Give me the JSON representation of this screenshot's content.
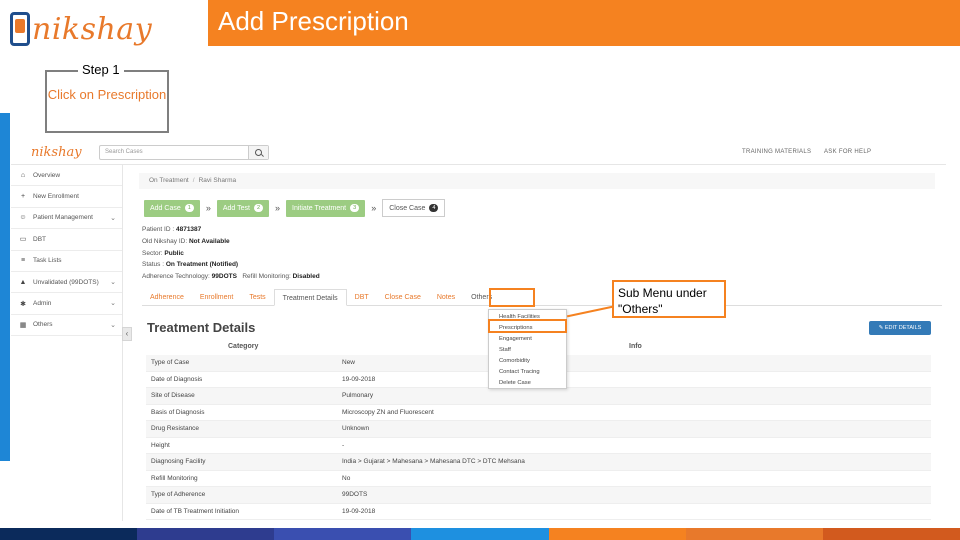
{
  "slide": {
    "logo_text": "nikshay",
    "title": "Add Prescription",
    "step_label": "Step 1",
    "step_text": "Click on Prescription",
    "callout_text": "Sub Menu under \"Others\"",
    "bottom_colors": [
      "#0b2a5b",
      "#2e3c8f",
      "#3a4fb0",
      "#1e90e0",
      "#f58220",
      "#e8792b",
      "#d25a1e"
    ]
  },
  "app": {
    "logo_text": "nikshay",
    "search_placeholder": "Search Cases",
    "top_links": [
      "TRAINING MATERIALS",
      "ASK FOR HELP"
    ],
    "sidebar": [
      {
        "icon": "home-icon",
        "glyph": "⌂",
        "label": "Overview",
        "chevron": false
      },
      {
        "icon": "plus-icon",
        "glyph": "+",
        "label": "New Enrollment",
        "chevron": false
      },
      {
        "icon": "user-icon",
        "glyph": "☺",
        "label": "Patient Management",
        "chevron": true
      },
      {
        "icon": "card-icon",
        "glyph": "▭",
        "label": "DBT",
        "chevron": false
      },
      {
        "icon": "list-icon",
        "glyph": "≡",
        "label": "Task Lists",
        "chevron": false
      },
      {
        "icon": "alert-icon",
        "glyph": "▲",
        "label": "Unvalidated (99DOTS)",
        "chevron": true
      },
      {
        "icon": "gear-icon",
        "glyph": "✱",
        "label": "Admin",
        "chevron": true
      },
      {
        "icon": "grid-icon",
        "glyph": "▦",
        "label": "Others",
        "chevron": true
      }
    ],
    "breadcrumb": [
      "On Treatment",
      "Ravi Sharma"
    ],
    "buttons": [
      {
        "label": "Add Case",
        "count": "1",
        "style": "green"
      },
      {
        "label": "Add Test",
        "count": "2",
        "style": "green"
      },
      {
        "label": "Initiate Treatment",
        "count": "3",
        "style": "green"
      },
      {
        "label": "Close Case",
        "count": "4",
        "style": "white"
      }
    ],
    "patient": {
      "id_label": "Patient ID",
      "id_value": "4871387",
      "nikshay_label": "Old Nikshay ID:",
      "nikshay_value": "Not Available",
      "sector_label": "Sector:",
      "sector_value": "Public",
      "status_label": "Status :",
      "status_value": "On Treatment (Notified)",
      "adherence_label": "Adherence Technology:",
      "adherence_value": "99DOTS",
      "refill_label": "Refill Monitoring:",
      "refill_value": "Disabled"
    },
    "tabs": [
      "Adherence",
      "Enrollment",
      "Tests",
      "Treatment Details",
      "DBT",
      "Close Case",
      "Notes",
      "Others"
    ],
    "dropdown": [
      "Health Facilities",
      "Prescriptions",
      "Engagement",
      "Staff",
      "Comorbidity",
      "Contact Tracing",
      "Delete Case"
    ],
    "section_title": "Treatment Details",
    "edit_button": "EDIT DETAILS",
    "table_headers": {
      "category": "Category",
      "info": "Info"
    },
    "rows": [
      {
        "k": "Type of Case",
        "v": "New"
      },
      {
        "k": "Date of Diagnosis",
        "v": "19-09-2018"
      },
      {
        "k": "Site of Disease",
        "v": "Pulmonary"
      },
      {
        "k": "Basis of Diagnosis",
        "v": "Microscopy ZN and Fluorescent"
      },
      {
        "k": "Drug Resistance",
        "v": "Unknown"
      },
      {
        "k": "Height",
        "v": "-"
      },
      {
        "k": "Diagnosing Facility",
        "v": "India > Gujarat > Mahesana > Mahesana DTC > DTC Mehsana"
      },
      {
        "k": "Refill Monitoring",
        "v": "No"
      },
      {
        "k": "Type of Adherence",
        "v": "99DOTS"
      },
      {
        "k": "Date of TB Treatment Initiation",
        "v": "19-09-2018"
      }
    ]
  }
}
